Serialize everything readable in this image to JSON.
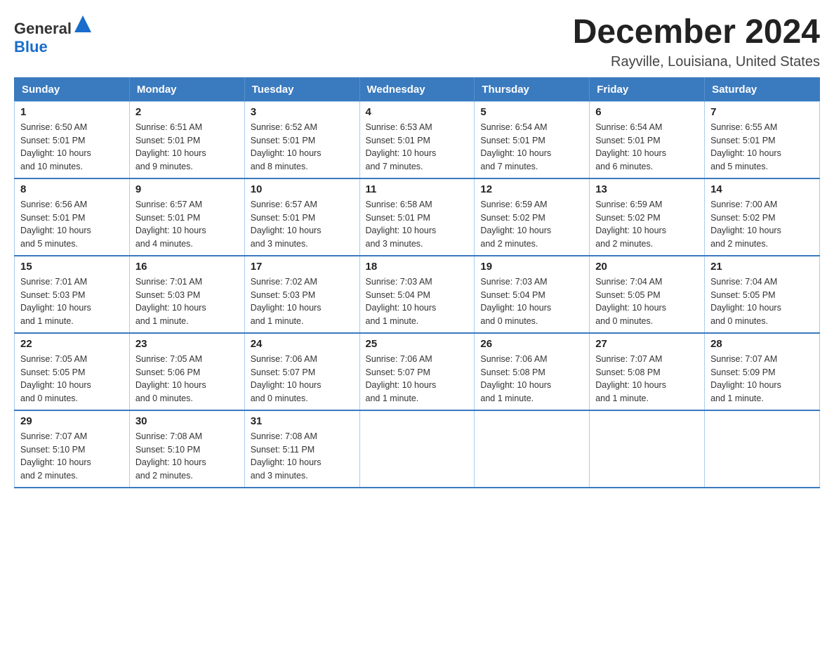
{
  "header": {
    "logo_general": "General",
    "logo_blue": "Blue",
    "title": "December 2024",
    "subtitle": "Rayville, Louisiana, United States"
  },
  "calendar": {
    "weekdays": [
      "Sunday",
      "Monday",
      "Tuesday",
      "Wednesday",
      "Thursday",
      "Friday",
      "Saturday"
    ],
    "weeks": [
      [
        {
          "day": "1",
          "sunrise": "6:50 AM",
          "sunset": "5:01 PM",
          "daylight": "10 hours and 10 minutes."
        },
        {
          "day": "2",
          "sunrise": "6:51 AM",
          "sunset": "5:01 PM",
          "daylight": "10 hours and 9 minutes."
        },
        {
          "day": "3",
          "sunrise": "6:52 AM",
          "sunset": "5:01 PM",
          "daylight": "10 hours and 8 minutes."
        },
        {
          "day": "4",
          "sunrise": "6:53 AM",
          "sunset": "5:01 PM",
          "daylight": "10 hours and 7 minutes."
        },
        {
          "day": "5",
          "sunrise": "6:54 AM",
          "sunset": "5:01 PM",
          "daylight": "10 hours and 7 minutes."
        },
        {
          "day": "6",
          "sunrise": "6:54 AM",
          "sunset": "5:01 PM",
          "daylight": "10 hours and 6 minutes."
        },
        {
          "day": "7",
          "sunrise": "6:55 AM",
          "sunset": "5:01 PM",
          "daylight": "10 hours and 5 minutes."
        }
      ],
      [
        {
          "day": "8",
          "sunrise": "6:56 AM",
          "sunset": "5:01 PM",
          "daylight": "10 hours and 5 minutes."
        },
        {
          "day": "9",
          "sunrise": "6:57 AM",
          "sunset": "5:01 PM",
          "daylight": "10 hours and 4 minutes."
        },
        {
          "day": "10",
          "sunrise": "6:57 AM",
          "sunset": "5:01 PM",
          "daylight": "10 hours and 3 minutes."
        },
        {
          "day": "11",
          "sunrise": "6:58 AM",
          "sunset": "5:01 PM",
          "daylight": "10 hours and 3 minutes."
        },
        {
          "day": "12",
          "sunrise": "6:59 AM",
          "sunset": "5:02 PM",
          "daylight": "10 hours and 2 minutes."
        },
        {
          "day": "13",
          "sunrise": "6:59 AM",
          "sunset": "5:02 PM",
          "daylight": "10 hours and 2 minutes."
        },
        {
          "day": "14",
          "sunrise": "7:00 AM",
          "sunset": "5:02 PM",
          "daylight": "10 hours and 2 minutes."
        }
      ],
      [
        {
          "day": "15",
          "sunrise": "7:01 AM",
          "sunset": "5:03 PM",
          "daylight": "10 hours and 1 minute."
        },
        {
          "day": "16",
          "sunrise": "7:01 AM",
          "sunset": "5:03 PM",
          "daylight": "10 hours and 1 minute."
        },
        {
          "day": "17",
          "sunrise": "7:02 AM",
          "sunset": "5:03 PM",
          "daylight": "10 hours and 1 minute."
        },
        {
          "day": "18",
          "sunrise": "7:03 AM",
          "sunset": "5:04 PM",
          "daylight": "10 hours and 1 minute."
        },
        {
          "day": "19",
          "sunrise": "7:03 AM",
          "sunset": "5:04 PM",
          "daylight": "10 hours and 0 minutes."
        },
        {
          "day": "20",
          "sunrise": "7:04 AM",
          "sunset": "5:05 PM",
          "daylight": "10 hours and 0 minutes."
        },
        {
          "day": "21",
          "sunrise": "7:04 AM",
          "sunset": "5:05 PM",
          "daylight": "10 hours and 0 minutes."
        }
      ],
      [
        {
          "day": "22",
          "sunrise": "7:05 AM",
          "sunset": "5:05 PM",
          "daylight": "10 hours and 0 minutes."
        },
        {
          "day": "23",
          "sunrise": "7:05 AM",
          "sunset": "5:06 PM",
          "daylight": "10 hours and 0 minutes."
        },
        {
          "day": "24",
          "sunrise": "7:06 AM",
          "sunset": "5:07 PM",
          "daylight": "10 hours and 0 minutes."
        },
        {
          "day": "25",
          "sunrise": "7:06 AM",
          "sunset": "5:07 PM",
          "daylight": "10 hours and 1 minute."
        },
        {
          "day": "26",
          "sunrise": "7:06 AM",
          "sunset": "5:08 PM",
          "daylight": "10 hours and 1 minute."
        },
        {
          "day": "27",
          "sunrise": "7:07 AM",
          "sunset": "5:08 PM",
          "daylight": "10 hours and 1 minute."
        },
        {
          "day": "28",
          "sunrise": "7:07 AM",
          "sunset": "5:09 PM",
          "daylight": "10 hours and 1 minute."
        }
      ],
      [
        {
          "day": "29",
          "sunrise": "7:07 AM",
          "sunset": "5:10 PM",
          "daylight": "10 hours and 2 minutes."
        },
        {
          "day": "30",
          "sunrise": "7:08 AM",
          "sunset": "5:10 PM",
          "daylight": "10 hours and 2 minutes."
        },
        {
          "day": "31",
          "sunrise": "7:08 AM",
          "sunset": "5:11 PM",
          "daylight": "10 hours and 3 minutes."
        },
        null,
        null,
        null,
        null
      ]
    ],
    "labels": {
      "sunrise": "Sunrise:",
      "sunset": "Sunset:",
      "daylight": "Daylight:"
    }
  }
}
